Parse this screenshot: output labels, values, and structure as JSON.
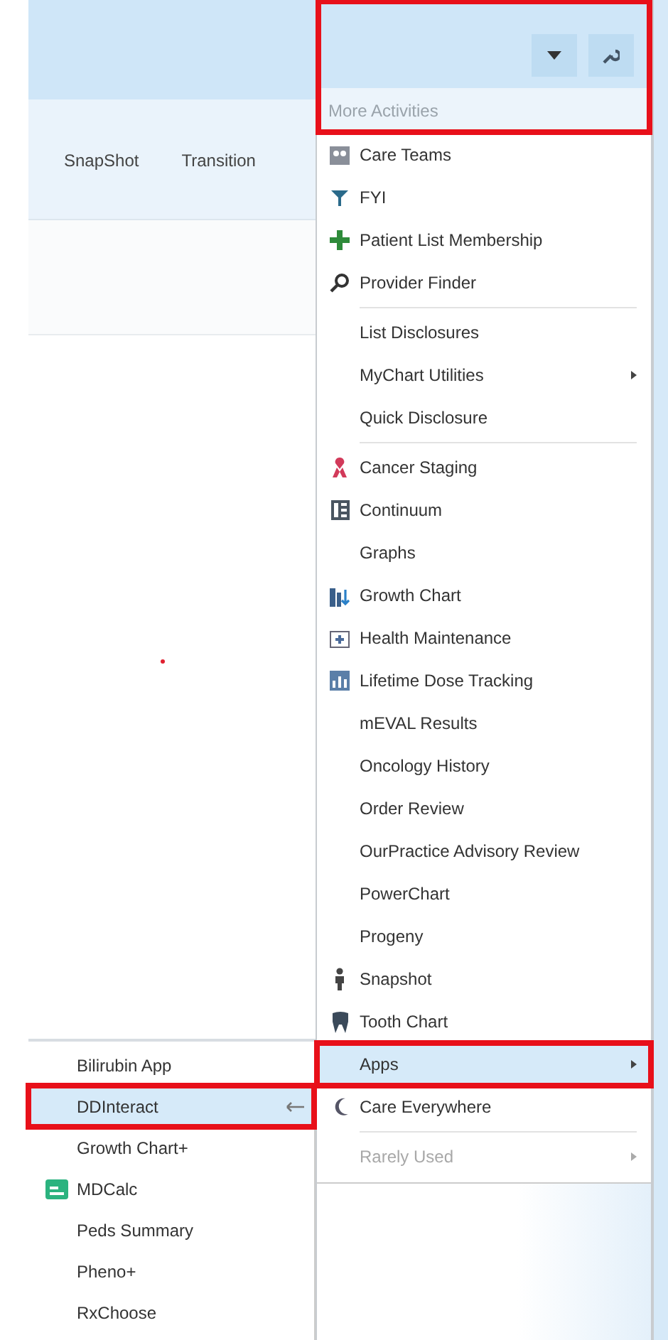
{
  "tabs": [
    {
      "label": "SnapShot"
    },
    {
      "label": "Transition"
    }
  ],
  "activities_menu": {
    "annotated": true,
    "title": "More Activities",
    "sections": [
      [
        {
          "label": "Care Teams"
        },
        {
          "label": "FYI"
        },
        {
          "label": "Patient List Membership"
        },
        {
          "label": "Provider Finder"
        }
      ],
      [
        {
          "label": "List Disclosures"
        },
        {
          "label": "MyChart Utilities",
          "submenu": true
        },
        {
          "label": "Quick Disclosure"
        }
      ],
      [
        {
          "label": "Cancer Staging"
        },
        {
          "label": "Continuum"
        },
        {
          "label": "Graphs"
        },
        {
          "label": "Growth Chart"
        },
        {
          "label": "Health Maintenance"
        },
        {
          "label": "Lifetime Dose Tracking"
        },
        {
          "label": "mEVAL Results"
        },
        {
          "label": "Oncology History"
        },
        {
          "label": "Order Review"
        },
        {
          "label": "OurPractice Advisory Review"
        },
        {
          "label": "PowerChart"
        },
        {
          "label": "Progeny"
        },
        {
          "label": "Snapshot"
        },
        {
          "label": "Tooth Chart"
        },
        {
          "label": "Apps",
          "submenu": true,
          "selected": true,
          "annotated": true
        },
        {
          "label": "Care Everywhere"
        }
      ],
      [
        {
          "label": "Rarely Used",
          "submenu": true,
          "disabled": true
        }
      ]
    ]
  },
  "apps_menu": [
    {
      "label": "Bilirubin App",
      "selected": false
    },
    {
      "label": "DDInteract",
      "selected": true,
      "annotated": true
    },
    {
      "label": "Growth Chart+",
      "selected": false
    },
    {
      "label": "MDCalc",
      "selected": false
    },
    {
      "label": "Peds Summary",
      "selected": false
    },
    {
      "label": "Pheno+",
      "selected": false
    },
    {
      "label": "RxChoose",
      "selected": false
    }
  ]
}
